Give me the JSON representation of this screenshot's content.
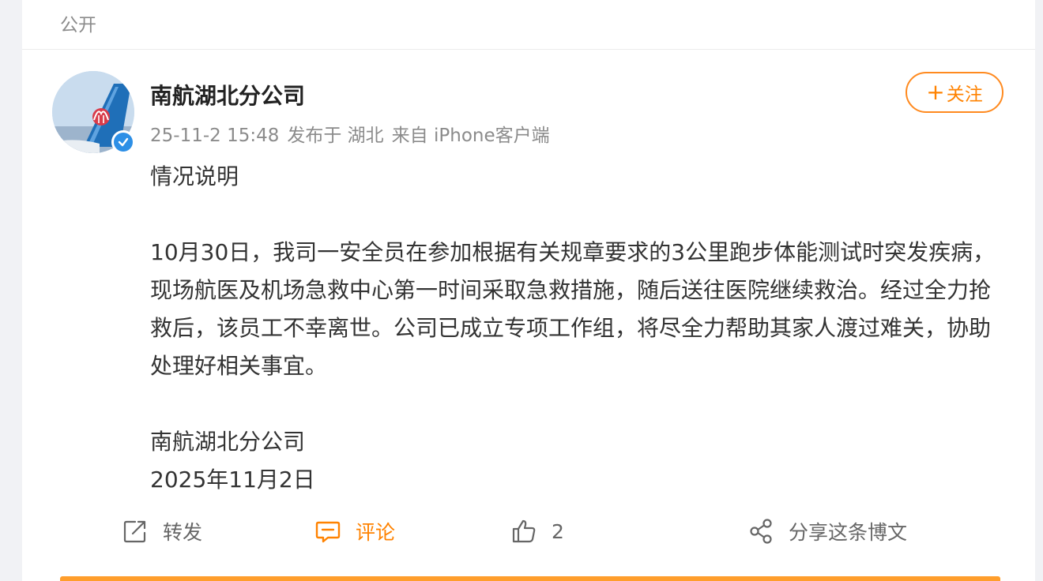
{
  "visibility_label": "公开",
  "post": {
    "author": "南航湖北分公司",
    "time": "25-11-2 15:48",
    "location": "发布于 湖北",
    "source": "来自 iPhone客户端",
    "follow_label": "关注",
    "title": "情况说明",
    "body": "10月30日，我司一安全员在参加根据有关规章要求的3公里跑步体能测试时突发疾病，现场航医及机场急救中心第一时间采取急救措施，随后送往医院继续救治。经过全力抢救后，该员工不幸离世。公司已成立专项工作组，将尽全力帮助其家人渡过难关，协助处理好相关事宜。",
    "signature": "南航湖北分公司",
    "date": "2025年11月2日"
  },
  "actions": {
    "repost_label": "转发",
    "comment_label": "评论",
    "like_count": "2",
    "share_label": "分享这条博文"
  },
  "colors": {
    "accent": "#ff8200",
    "verified": "#2d8fe6"
  },
  "icons": [
    "repost-icon",
    "comment-icon",
    "like-icon",
    "share-icon",
    "verified-icon",
    "plus-icon"
  ]
}
